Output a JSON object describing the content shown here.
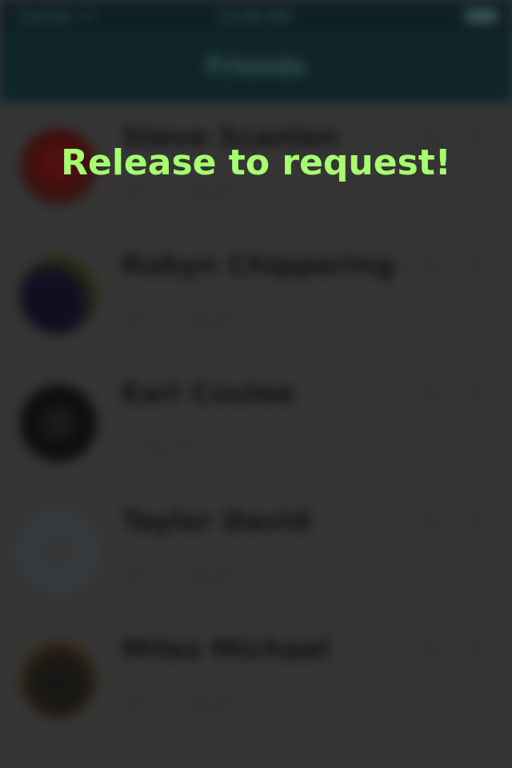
{
  "status_bar": {
    "carrier": "Carrier ••",
    "time": "12:00 PM"
  },
  "nav": {
    "title": "Friends"
  },
  "overlay": {
    "message": "Release to request!",
    "color": "#a6ff6e"
  },
  "contacts": [
    {
      "name": "Steve Scanlon",
      "subtitle": "Send a request",
      "time": "2 days ago"
    },
    {
      "name": "Robyn Chippering",
      "subtitle": "Send a request",
      "time": "3 days ago"
    },
    {
      "name": "Earl Coulee",
      "subtitle": "1 request",
      "time": "4 days ago"
    },
    {
      "name": "Taylor David",
      "subtitle": "Send a request",
      "time": "5 days ago"
    },
    {
      "name": "Miles Michael",
      "subtitle": "Send a request",
      "time": "6 days ago"
    }
  ]
}
